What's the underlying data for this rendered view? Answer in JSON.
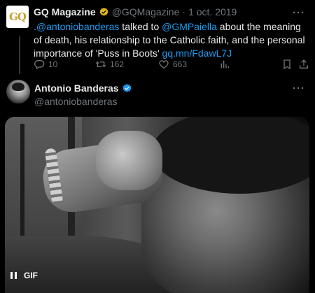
{
  "quoted_tweet": {
    "avatar_text": "GQ",
    "name": "GQ Magazine",
    "handle": "@GQMagazine",
    "separator": "·",
    "date": "1 oct. 2019",
    "text_parts": [
      {
        "text": ".@antoniobanderas",
        "link": true
      },
      {
        "text": " talked to ",
        "link": false
      },
      {
        "text": "@GMPaiella",
        "link": true
      },
      {
        "text": " about the meaning of death, his relationship to the Catholic faith, and the personal importance of 'Puss in Boots' ",
        "link": false
      },
      {
        "text": "gq.mn/FdawL7J",
        "link": true
      }
    ],
    "replies": "10",
    "retweets": "162",
    "likes": "663"
  },
  "main_tweet": {
    "name": "Antonio Banderas",
    "handle": "@antoniobanderas",
    "media_label": "GIF"
  },
  "colors": {
    "link": "#1d9bf0",
    "secondary": "#71767b",
    "verified_gold": "#e2b719",
    "verified_blue": "#1d9bf0"
  },
  "icons": [
    "gq-avatar",
    "verified-gold-icon",
    "more-icon",
    "reply-icon",
    "retweet-icon",
    "like-icon",
    "views-icon",
    "bookmark-icon",
    "share-icon",
    "verified-blue-icon",
    "pause-icon"
  ]
}
